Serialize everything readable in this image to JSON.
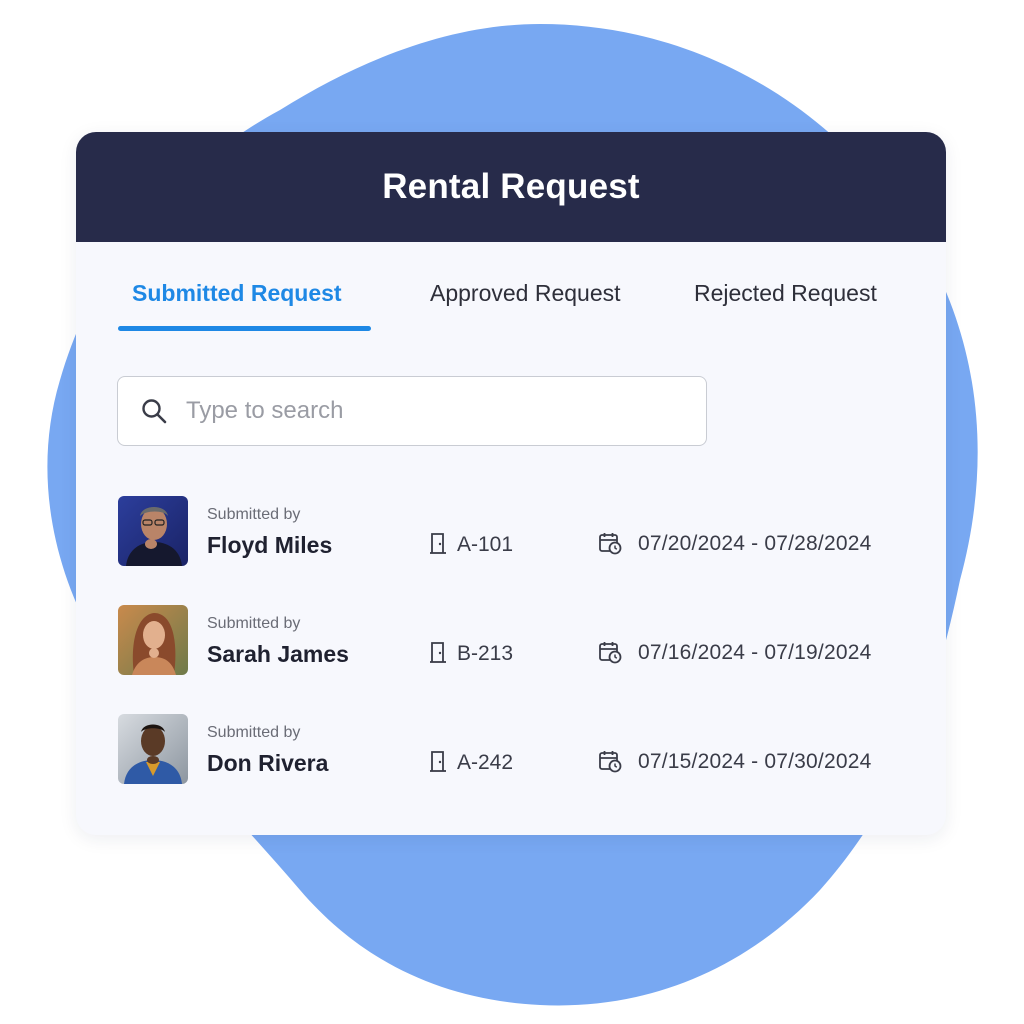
{
  "colors": {
    "blob": "#78a8f2",
    "header_bg": "#272b4a",
    "accent": "#1e88e5",
    "card_bg": "#f7f8fd"
  },
  "header": {
    "title": "Rental Request"
  },
  "tabs": [
    {
      "label": "Submitted Request",
      "active": true
    },
    {
      "label": "Approved Request",
      "active": false
    },
    {
      "label": "Rejected Request",
      "active": false
    }
  ],
  "search": {
    "placeholder": "Type to search",
    "icon": "search-icon"
  },
  "requests": [
    {
      "submitted_label": "Submitted by",
      "name": "Floyd Miles",
      "unit": "A-101",
      "dates": "07/20/2024 - 07/28/2024"
    },
    {
      "submitted_label": "Submitted by",
      "name": "Sarah James",
      "unit": "B-213",
      "dates": "07/16/2024 - 07/19/2024"
    },
    {
      "submitted_label": "Submitted by",
      "name": "Don Rivera",
      "unit": "A-242",
      "dates": "07/15/2024 - 07/30/2024"
    }
  ],
  "icons": {
    "unit": "door-icon",
    "dates": "calendar-clock-icon"
  }
}
